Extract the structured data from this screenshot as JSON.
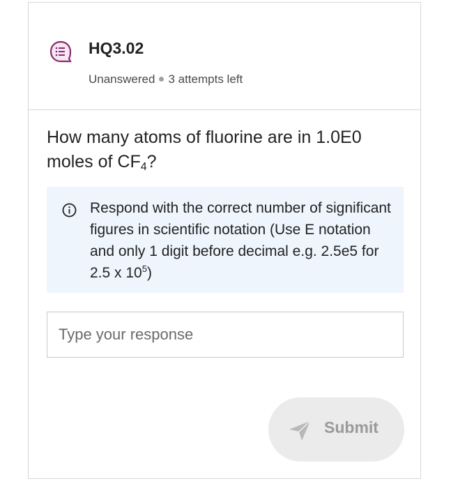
{
  "question": {
    "id": "HQ3.02",
    "status": "Unanswered",
    "attempts": "3 attempts left",
    "text_before_sub": "How many atoms of fluorine are in 1.0E0 moles of CF",
    "text_sub": "4",
    "text_after_sub": "?"
  },
  "info": {
    "text_main": "Respond with the correct number of significant figures in scientific notation (Use E notation and only 1 digit before decimal e.g. 2.5e5 for 2.5 x 10",
    "text_sup": "5",
    "text_end": ")"
  },
  "response": {
    "value": "",
    "placeholder": "Type your response"
  },
  "submit": {
    "label": "Submit"
  },
  "icons": {
    "question_icon": "question-list-icon",
    "info_icon": "info-icon",
    "submit_icon": "send-icon"
  },
  "colors": {
    "accent": "#8a2a6e",
    "info_bg": "#eef5fd",
    "submit_bg": "#ebebeb",
    "submit_text": "#9a9a9a"
  }
}
